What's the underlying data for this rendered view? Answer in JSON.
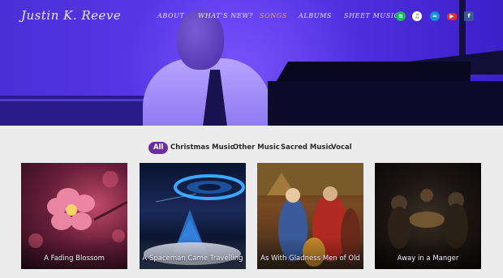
{
  "header": {
    "logo_text": "Justin K. Reeve",
    "nav": [
      {
        "label": "ABOUT",
        "active": false
      },
      {
        "label": "WHAT'S NEW?",
        "active": false
      },
      {
        "label": "SONGS",
        "active": true
      },
      {
        "label": "ALBUMS",
        "active": false
      },
      {
        "label": "SHEET MUSIC",
        "active": false
      }
    ],
    "social_icons": [
      {
        "name": "spotify-icon",
        "color": "#1db954"
      },
      {
        "name": "itunes-icon",
        "color": "#ffffff"
      },
      {
        "name": "amazon-music-icon",
        "color": "#1a8fd8"
      },
      {
        "name": "youtube-icon",
        "color": "#e52d27"
      },
      {
        "name": "facebook-icon",
        "color": "#3b5998"
      }
    ]
  },
  "filters": [
    {
      "label": "All",
      "active": true
    },
    {
      "label": "Christmas Music",
      "active": false
    },
    {
      "label": "Other Music",
      "active": false
    },
    {
      "label": "Sacred Music",
      "active": false
    },
    {
      "label": "Vocal",
      "active": false
    }
  ],
  "songs": [
    {
      "title": "A Fading Blossom"
    },
    {
      "title": "A Spaceman Came Travelling"
    },
    {
      "title": "As With Gladness Men of Old"
    },
    {
      "title": "Away in a Manger"
    }
  ],
  "colors": {
    "accent": "#6a2ea0",
    "nav_active": "#f0a640",
    "hero": "#5c3bf0"
  }
}
